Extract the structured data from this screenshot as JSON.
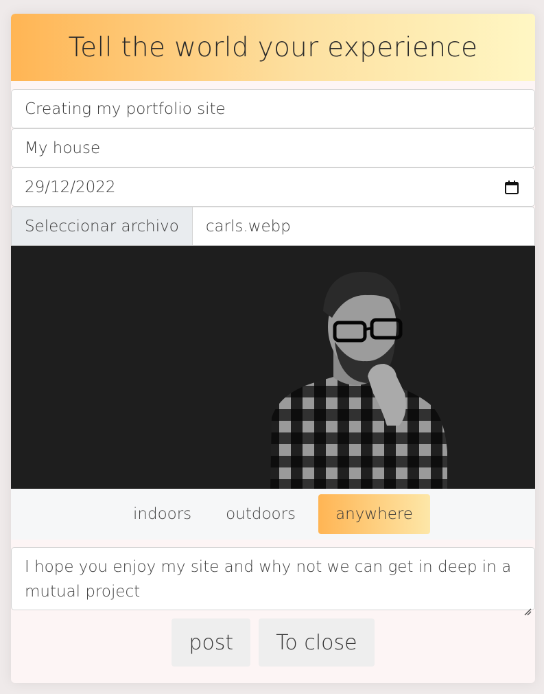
{
  "header": {
    "title": "Tell the world your experience"
  },
  "form": {
    "title_value": "Creating my portfolio site",
    "place_value": "My house",
    "date_value": "29/12/2022",
    "file": {
      "button_label": "Seleccionar archivo",
      "file_name": "carls.webp"
    },
    "options": [
      {
        "label": "indoors",
        "selected": false
      },
      {
        "label": "outdoors",
        "selected": false
      },
      {
        "label": "anywhere",
        "selected": true
      }
    ],
    "comment": "I hope you enjoy my site and why not we can get in deep in a mutual project"
  },
  "actions": {
    "post_label": "post",
    "close_label": "To close"
  },
  "icons": {
    "date": "calendar-icon",
    "resize": "resize-handle-icon"
  },
  "colors": {
    "accent_start": "#ffb554",
    "accent_end": "#fff7c4"
  }
}
